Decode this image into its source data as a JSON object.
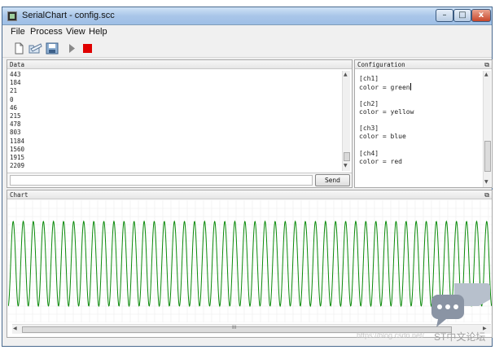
{
  "window": {
    "title": "SerialChart - config.scc",
    "controls": {
      "minimize": "–",
      "maximize": "□",
      "close": "x"
    }
  },
  "menu": [
    "File",
    "Process",
    "View",
    "Help"
  ],
  "toolbar": {
    "items": [
      "new-file-icon",
      "open-folder-icon",
      "save-icon",
      "run-icon",
      "stop-icon"
    ],
    "stop_color": "#e00000",
    "run_color": "#808080"
  },
  "data_panel": {
    "title": "Data",
    "values": [
      "443",
      "184",
      "21",
      "0",
      "46",
      "215",
      "478",
      "803",
      "1184",
      "1560",
      "1915",
      "2209"
    ],
    "send_label": "Send",
    "input_value": ""
  },
  "config_panel": {
    "title": "Configuration",
    "lines": [
      "[ch1]",
      "color = green",
      "",
      "[ch2]",
      "color = yellow",
      "",
      "[ch3]",
      "color = blue",
      "",
      "[ch4]",
      "color = red"
    ]
  },
  "chart_panel": {
    "title": "Chart",
    "scroll_grip": "III"
  },
  "chart_data": {
    "type": "line",
    "series": [
      {
        "color": "#0a8a0a",
        "cycles": 48
      }
    ],
    "grid": true
  },
  "watermark": {
    "url": "https://blog.csdn.net/",
    "brand": "ST中文论坛"
  }
}
